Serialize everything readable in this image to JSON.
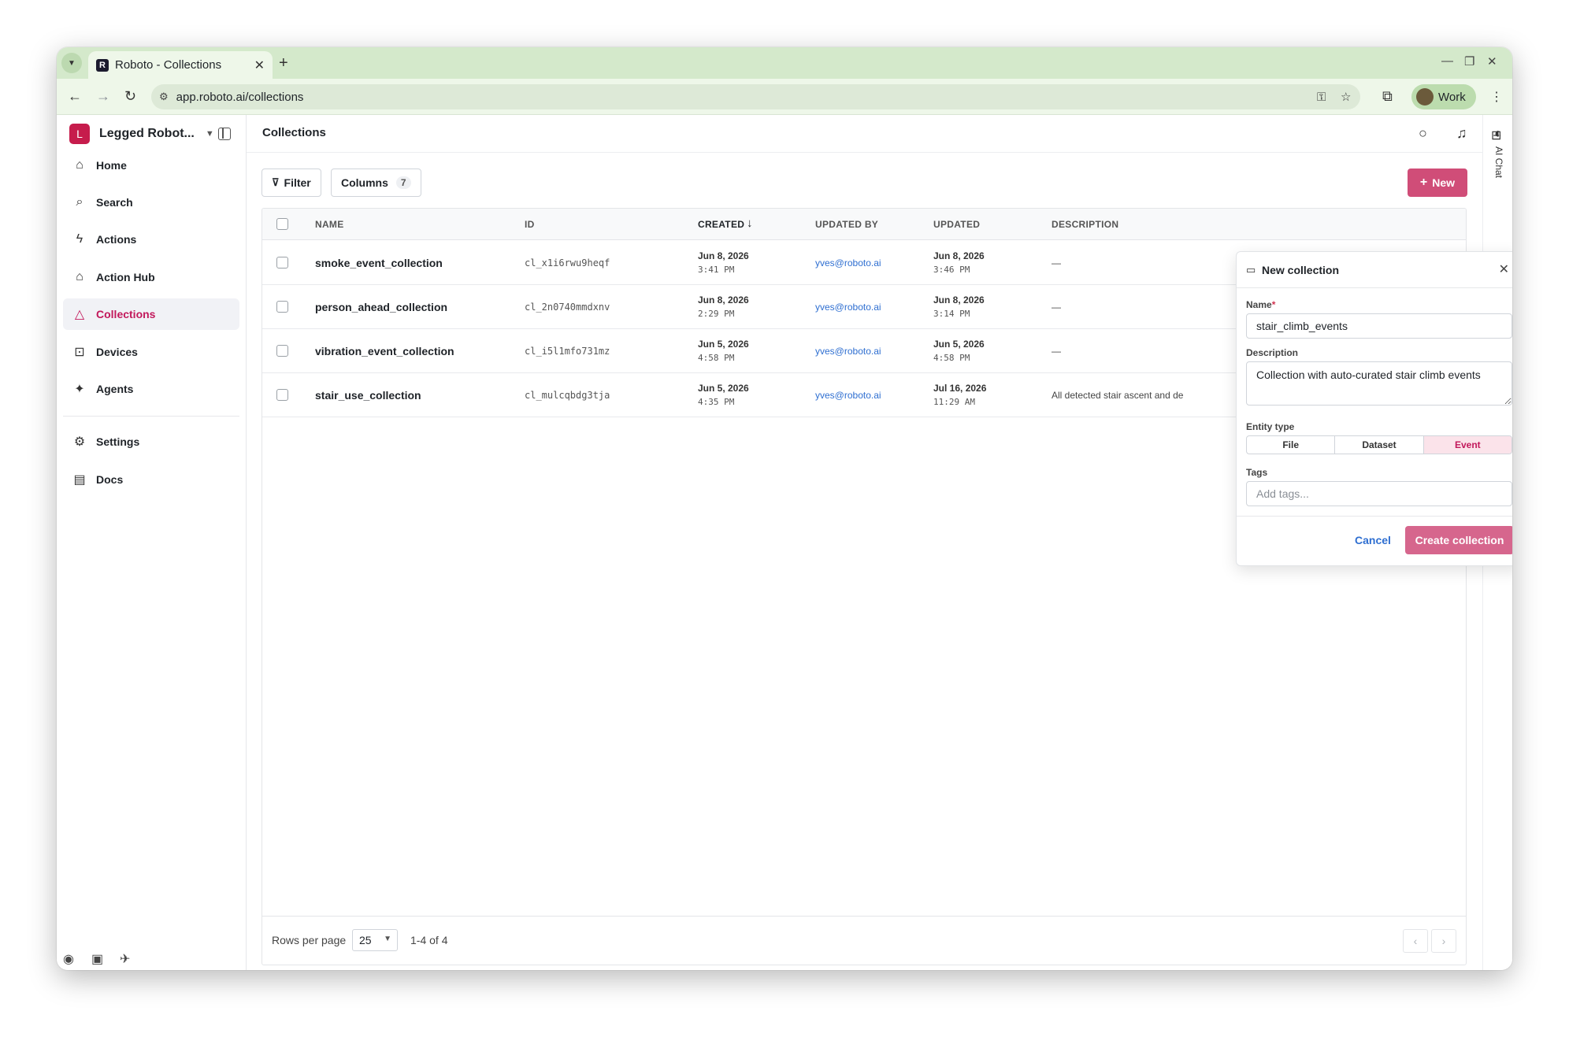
{
  "browser": {
    "tab_title": "Roboto - Collections",
    "url": "app.roboto.ai/collections",
    "profile_label": "Work"
  },
  "org": {
    "initial": "L",
    "name": "Legged Robot..."
  },
  "sidebar": {
    "items": [
      {
        "label": "Home",
        "icon": "home-icon"
      },
      {
        "label": "Search",
        "icon": "search-icon"
      },
      {
        "label": "Actions",
        "icon": "lightning-icon"
      },
      {
        "label": "Action Hub",
        "icon": "store-icon"
      },
      {
        "label": "Collections",
        "icon": "shapes-icon",
        "active": true
      },
      {
        "label": "Devices",
        "icon": "robot-icon"
      },
      {
        "label": "Agents",
        "icon": "sparkles-icon"
      },
      {
        "label": "Settings",
        "icon": "gear-icon"
      },
      {
        "label": "Docs",
        "icon": "document-icon"
      }
    ]
  },
  "header": {
    "title": "Collections",
    "ai_chat_label": "AI Chat"
  },
  "toolbar": {
    "filter_label": "Filter",
    "columns_label": "Columns",
    "columns_count": "7",
    "new_label": "New"
  },
  "table": {
    "headers": {
      "name": "NAME",
      "id": "ID",
      "created": "CREATED",
      "updated_by": "UPDATED BY",
      "updated": "UPDATED",
      "description": "DESCRIPTION"
    },
    "rows": [
      {
        "name": "smoke_event_collection",
        "id": "cl_x1i6rwu9heqf",
        "created_date": "Jun 8, 2026",
        "created_time": "3:41 PM",
        "updated_by": "yves@roboto.ai",
        "updated_date": "Jun 8, 2026",
        "updated_time": "3:46 PM",
        "description": "—"
      },
      {
        "name": "person_ahead_collection",
        "id": "cl_2n0740mmdxnv",
        "created_date": "Jun 8, 2026",
        "created_time": "2:29 PM",
        "updated_by": "yves@roboto.ai",
        "updated_date": "Jun 8, 2026",
        "updated_time": "3:14 PM",
        "description": "—"
      },
      {
        "name": "vibration_event_collection",
        "id": "cl_i5l1mfo731mz",
        "created_date": "Jun 5, 2026",
        "created_time": "4:58 PM",
        "updated_by": "yves@roboto.ai",
        "updated_date": "Jun 5, 2026",
        "updated_time": "4:58 PM",
        "description": "—"
      },
      {
        "name": "stair_use_collection",
        "id": "cl_mulcqbdg3tja",
        "created_date": "Jun 5, 2026",
        "created_time": "4:35 PM",
        "updated_by": "yves@roboto.ai",
        "updated_date": "Jul 16, 2026",
        "updated_time": "11:29 AM",
        "description": "All detected stair ascent and de"
      }
    ]
  },
  "pagination": {
    "rows_per_page_label": "Rows per page",
    "rows_per_page_value": "25",
    "range": "1-4 of 4"
  },
  "new_collection": {
    "title": "New collection",
    "name_label": "Name",
    "name_required_mark": "*",
    "name_value": "stair_climb_events",
    "description_label": "Description",
    "description_value": "Collection with auto-curated stair climb events",
    "entity_type_label": "Entity type",
    "entity_types": [
      "File",
      "Dataset",
      "Event"
    ],
    "entity_type_selected": "Event",
    "tags_label": "Tags",
    "tags_placeholder": "Add tags...",
    "cancel_label": "Cancel",
    "create_label": "Create collection"
  },
  "colors": {
    "brand": "#c61c4c",
    "primary_button": "#d04d78",
    "link": "#2f6fd1",
    "tab_strip": "#d4e9cb"
  }
}
